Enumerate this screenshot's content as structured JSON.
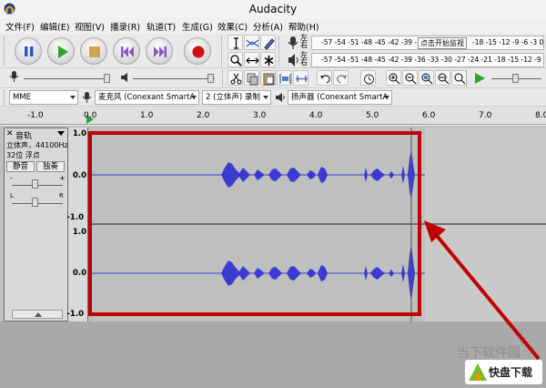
{
  "window": {
    "title": "Audacity"
  },
  "menu": [
    {
      "label": "文件(F)"
    },
    {
      "label": "编辑(E)"
    },
    {
      "label": "视图(V)"
    },
    {
      "label": "播录(R)"
    },
    {
      "label": "轨道(T)"
    },
    {
      "label": "生成(G)"
    },
    {
      "label": "效果(C)"
    },
    {
      "label": "分析(A)"
    },
    {
      "label": "帮助(H)"
    }
  ],
  "meters": {
    "record_scale": "-57 -54 -51 -48 -45 -42 -39 -",
    "record_prompt": "点击开始监视",
    "record_scale_right": "-18 -15 -12 -9 -6 -3 0",
    "play_scale": "-57 -54 -51 -48 -45 -42 -39 -36 -33 -30 -27 -24 -21 -18 -15 -12 -9 -6 -3 0",
    "lr_label_top": "左",
    "lr_label_bottom": "右"
  },
  "device": {
    "host": "MME",
    "mic": "麦克风 (Conexant SmartA",
    "channels": "2 (立体声) 录制",
    "speaker": "扬声器 (Conexant SmartA"
  },
  "timeline": {
    "ticks": [
      "-1.0",
      "0.0",
      "1.0",
      "2.0",
      "3.0",
      "4.0",
      "5.0",
      "6.0",
      "7.0",
      "8.0"
    ]
  },
  "track": {
    "name": "音轨",
    "info1": "立体声，44100Hz",
    "info2": "32位 浮点",
    "mute": "静音",
    "solo": "独奏",
    "gain_minus": "-",
    "gain_plus": "+",
    "pan_left": "L",
    "pan_right": "R",
    "scale_ch1": [
      "1.0",
      "0.0",
      "-1.0"
    ],
    "scale_ch2": [
      "1.0",
      "0.0",
      "-1.0"
    ],
    "close": "✕"
  },
  "watermark": {
    "text": "当下软件园"
  },
  "logo": {
    "text": "快盘下载"
  },
  "colors": {
    "waveform": "#3b3bd0",
    "highlight": "#c00000",
    "play": "#2aa52a",
    "record": "#d01010",
    "pause": "#2b56c8"
  }
}
